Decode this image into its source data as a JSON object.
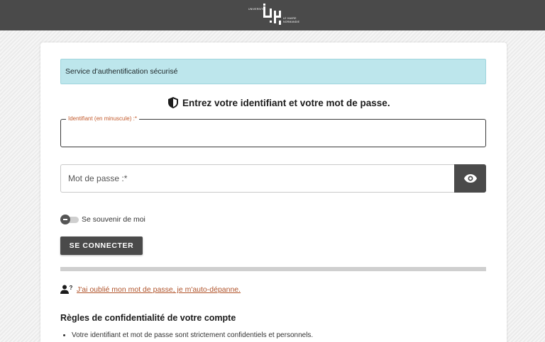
{
  "header": {
    "logo": {
      "text_top": "UNIVERSITÉ",
      "text_mid": "LE HAVRE",
      "text_bottom": "NORMANDIE",
      "icon": "university-logo-icon"
    }
  },
  "alert": {
    "text": "Service d'authentification sécurisé"
  },
  "form": {
    "heading": "Entrez votre identifiant et votre mot de passe.",
    "heading_icon": "shield-icon",
    "username": {
      "label": "Identifiant (en minuscule) :*",
      "value": ""
    },
    "password": {
      "placeholder": "Mot de passe :*",
      "value": "",
      "toggle_icon": "eye-icon"
    },
    "remember": {
      "label": "Se souvenir de moi",
      "checked": false
    },
    "submit_label": "SE CONNECTER",
    "forgot": {
      "icon": "user-question-icon",
      "link": "J'ai oublié mon mot de passe, je m'auto-dépanne."
    }
  },
  "rules": {
    "title": "Règles de confidentialité de votre compte",
    "items": [
      "Votre identifiant et mot de passe sont strictement confidentiels et personnels."
    ]
  },
  "colors": {
    "topbar": "#4a4a4a",
    "alert_bg": "#bde6ec",
    "link": "#b0532a",
    "button": "#4a4a4a"
  }
}
